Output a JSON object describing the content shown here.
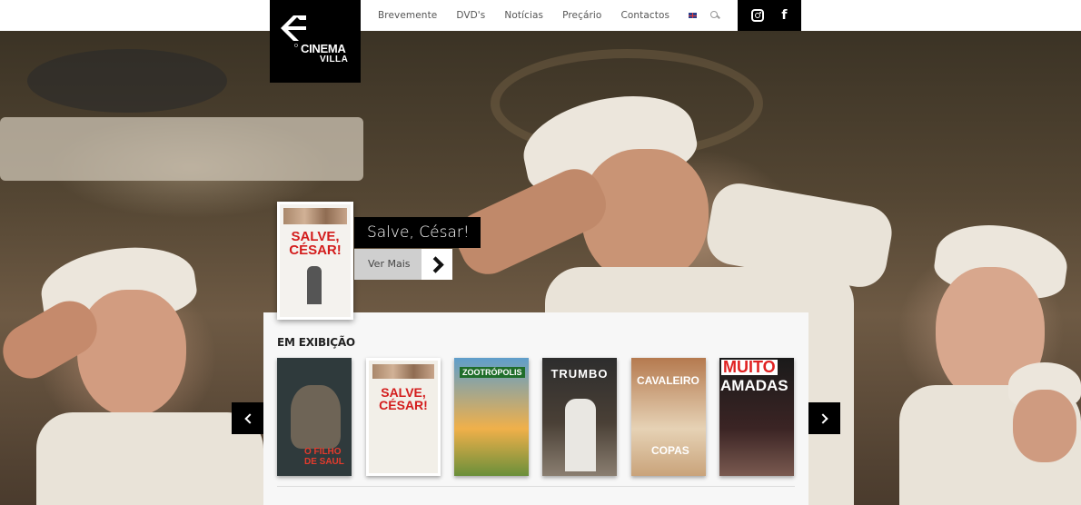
{
  "brand": {
    "logo_small": "O",
    "logo_line1": "CINEMA",
    "logo_line2": "VILLA"
  },
  "nav": {
    "items": [
      {
        "label": "Brevemente"
      },
      {
        "label": "DVD's"
      },
      {
        "label": "Notícias"
      },
      {
        "label": "Preçário"
      },
      {
        "label": "Contactos"
      }
    ]
  },
  "featured": {
    "title": "Salve, César!",
    "more_label": "Ver Mais",
    "poster_title_line1": "SALVE,",
    "poster_title_line2": "CÉSAR!"
  },
  "now_showing": {
    "heading": "EM EXIBIÇÃO",
    "posters": [
      {
        "text1": "O FILHO",
        "text2": "DE SAUL",
        "bg": "#2f3a3c"
      },
      {
        "text1": "SALVE,",
        "text2": "CÉSAR!",
        "bg": "#f2efe8"
      },
      {
        "text1": "ZOOTRÓPOLIS",
        "text2": "",
        "bg": "#6aa3c6"
      },
      {
        "text1": "TRUMBO",
        "text2": "",
        "bg": "#2c2c2c"
      },
      {
        "text1": "CAVALEIRO",
        "text2": "COPAS",
        "bg": "#c9a37a"
      },
      {
        "text1": "MUITO",
        "text2": "AMADAS",
        "bg": "#1a1a1a"
      }
    ]
  },
  "colors": {
    "accent_red": "#d31c1c",
    "dark": "#000000"
  }
}
